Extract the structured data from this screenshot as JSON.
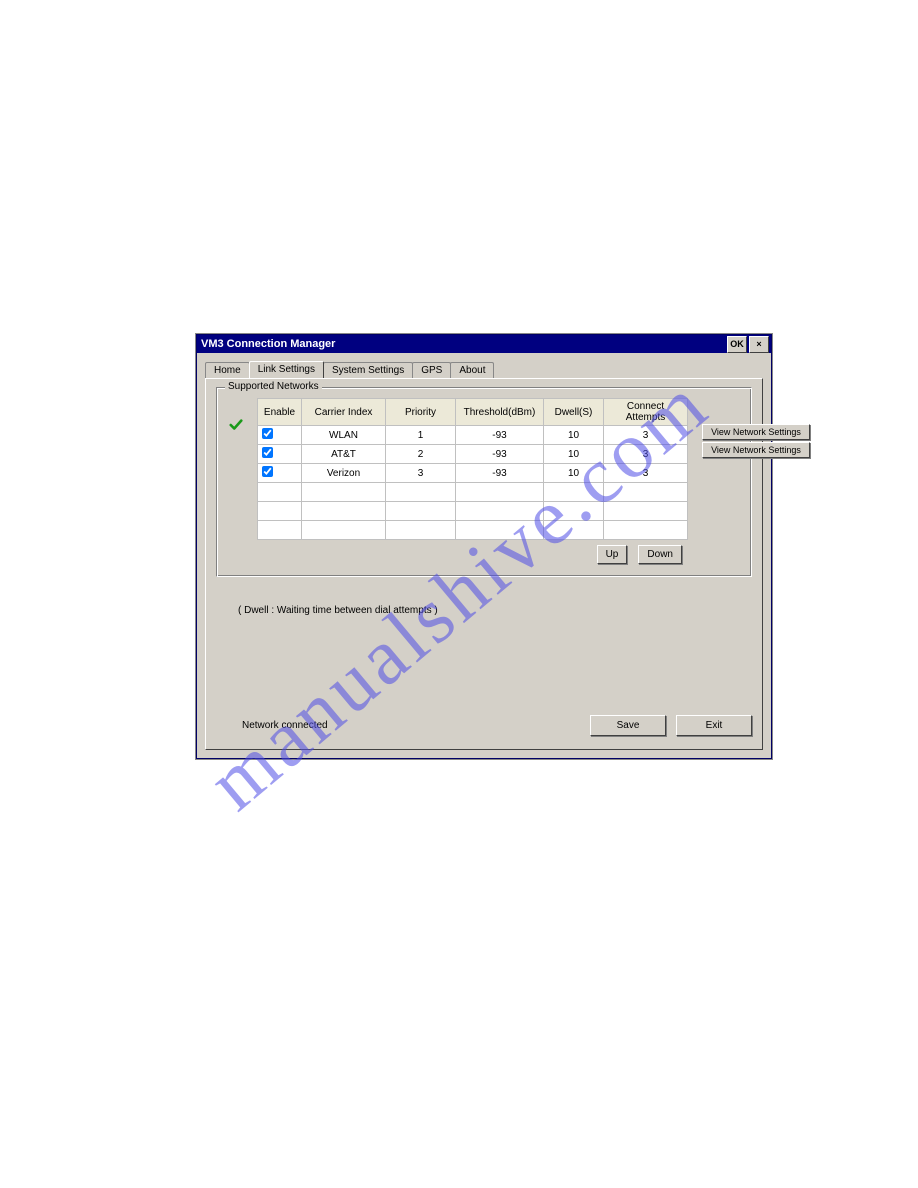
{
  "watermark": "manualshive.com",
  "window": {
    "title": "VM3 Connection Manager",
    "ok_label": "OK",
    "close_label": "×"
  },
  "tabs": [
    {
      "label": "Home"
    },
    {
      "label": "Link Settings"
    },
    {
      "label": "System Settings"
    },
    {
      "label": "GPS"
    },
    {
      "label": "About"
    }
  ],
  "groupbox_title": "Supported Networks",
  "columns": {
    "enable": "Enable",
    "carrier": "Carrier Index",
    "priority": "Priority",
    "threshold": "Threshold(dBm)",
    "dwell": "Dwell(S)",
    "attempts": "Connect Attempts"
  },
  "rows": [
    {
      "enable": true,
      "carrier": "WLAN",
      "priority": "1",
      "threshold": "-93",
      "dwell": "10",
      "attempts": "3",
      "active": true
    },
    {
      "enable": true,
      "carrier": "AT&T",
      "priority": "2",
      "threshold": "-93",
      "dwell": "10",
      "attempts": "3",
      "active": false
    },
    {
      "enable": true,
      "carrier": "Verizon",
      "priority": "3",
      "threshold": "-93",
      "dwell": "10",
      "attempts": "3",
      "active": false
    }
  ],
  "side_buttons": {
    "view1": "View Network Settings",
    "view2": "View Network Settings"
  },
  "updown": {
    "up": "Up",
    "down": "Down"
  },
  "hint": "( Dwell : Waiting time between dial attempts )",
  "status": "Network connected",
  "footer": {
    "save": "Save",
    "exit": "Exit"
  }
}
